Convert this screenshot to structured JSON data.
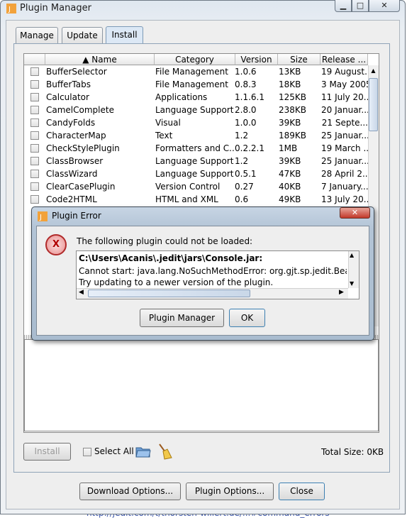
{
  "window": {
    "title": "Plugin Manager",
    "min": "▁",
    "max": "□",
    "close": "✕"
  },
  "tabs": [
    {
      "label": "Manage"
    },
    {
      "label": "Update"
    },
    {
      "label": "Install"
    }
  ],
  "table": {
    "columns": [
      "▲ Name",
      "Category",
      "Version",
      "Size",
      "Release ..."
    ],
    "rows": [
      {
        "name": "BufferSelector",
        "category": "File Management",
        "version": "1.0.6",
        "size": "13KB",
        "release": "19 August..."
      },
      {
        "name": "BufferTabs",
        "category": "File Management",
        "version": "0.8.3",
        "size": "18KB",
        "release": "3 May 2005"
      },
      {
        "name": "Calculator",
        "category": "Applications",
        "version": "1.1.6.1",
        "size": "125KB",
        "release": "11 July 20..."
      },
      {
        "name": "CamelComplete",
        "category": "Language Support",
        "version": "2.8.0",
        "size": "238KB",
        "release": "20 Januar..."
      },
      {
        "name": "CandyFolds",
        "category": "Visual",
        "version": "1.0.0",
        "size": "39KB",
        "release": "21 Septe..."
      },
      {
        "name": "CharacterMap",
        "category": "Text",
        "version": "1.2",
        "size": "189KB",
        "release": "25 Januar..."
      },
      {
        "name": "CheckStylePlugin",
        "category": "Formatters and C...",
        "version": "0.2.2.1",
        "size": "1MB",
        "release": "19 March ..."
      },
      {
        "name": "ClassBrowser",
        "category": "Language Support",
        "version": "1.2",
        "size": "39KB",
        "release": "25 Januar..."
      },
      {
        "name": "ClassWizard",
        "category": "Language Support",
        "version": "0.5.1",
        "size": "47KB",
        "release": "28 April 2..."
      },
      {
        "name": "ClearCasePlugin",
        "category": "Version Control",
        "version": "0.27",
        "size": "40KB",
        "release": "7 January..."
      },
      {
        "name": "Code2HTML",
        "category": "HTML and XML",
        "version": "0.6",
        "size": "49KB",
        "release": "13 July 20..."
      }
    ]
  },
  "bottom": {
    "install": "Install",
    "select_all": "Select All",
    "total_size": "Total Size: 0KB"
  },
  "footer": {
    "download_options": "Download Options...",
    "plugin_options": "Plugin Options...",
    "close": "Close"
  },
  "dialog": {
    "title": "Plugin Error",
    "close": "✕",
    "icon_glyph": "X",
    "message": "The following plugin could not be loaded:",
    "path": "C:\\Users\\Acanis\\.jedit\\jars\\Console.jar:",
    "line1": "Cannot start: java.lang.NoSuchMethodError: org.gjt.sp.jedit.BeanShell",
    "line2": "Try updating to a newer version of the plugin.",
    "plugin_manager_btn": "Plugin Manager",
    "ok_btn": "OK"
  },
  "background_link": "http://jedit.com/t/thorsten-willert.de/...#command_errors"
}
